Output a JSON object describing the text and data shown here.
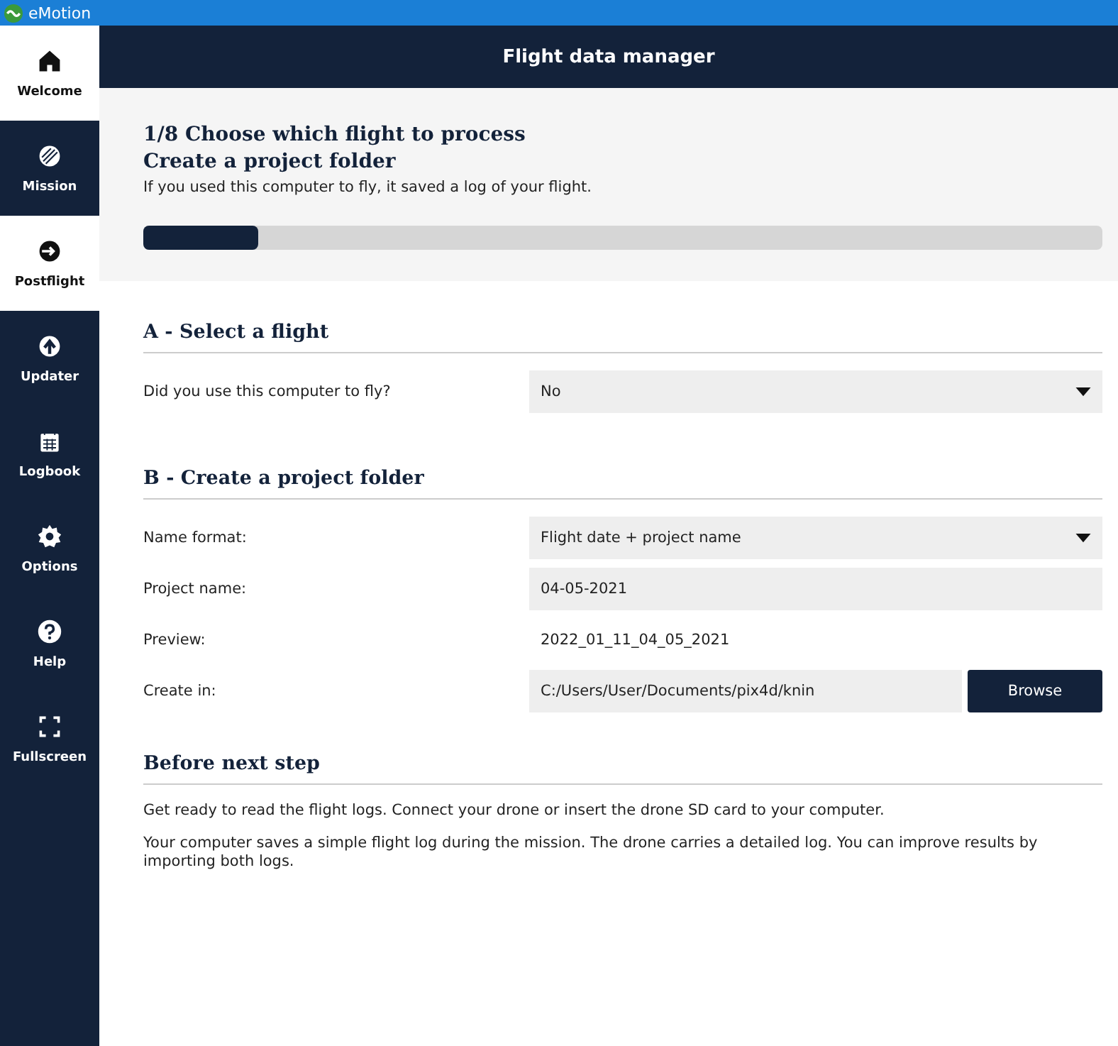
{
  "window": {
    "title": "eMotion"
  },
  "sidebar": {
    "items": [
      {
        "label": "Welcome",
        "kind": "home",
        "selected": true
      },
      {
        "label": "Mission",
        "kind": "mission",
        "selected": false
      },
      {
        "label": "Postflight",
        "kind": "postflight",
        "selected": true
      },
      {
        "label": "Updater",
        "kind": "updater",
        "selected": false
      },
      {
        "label": "Logbook",
        "kind": "logbook",
        "selected": false
      },
      {
        "label": "Options",
        "kind": "options",
        "selected": false
      },
      {
        "label": "Help",
        "kind": "help",
        "selected": false
      },
      {
        "label": "Fullscreen",
        "kind": "fullscreen",
        "selected": false
      }
    ]
  },
  "header": {
    "title": "Flight data manager"
  },
  "step": {
    "title": "1/8 Choose which flight to process",
    "subtitle": "Create a project folder",
    "description": "If you used this computer to fly, it saved a log of your flight.",
    "level": 0.12
  },
  "sections": [
    {
      "title": "A - Select a flight",
      "rows": [
        {
          "kind": "dropdown",
          "label": "Did you use this computer to fly?",
          "value": "No"
        }
      ]
    },
    {
      "title": "B - Create a project folder",
      "rows": [
        {
          "kind": "dropdown",
          "label": "Name format:",
          "value": "Flight date + project name"
        },
        {
          "kind": "field",
          "label": "Project name:",
          "value": "04-05-2021"
        },
        {
          "kind": "text",
          "label": "Preview:",
          "value": "2022_01_11_04_05_2021"
        },
        {
          "kind": "browse",
          "label": "Create in:",
          "value": "C:/Users/User/Documents/pix4d/knin",
          "button": "Browse"
        }
      ]
    },
    {
      "title": "Before next step",
      "paragraphs": [
        "Get ready to read the flight logs. Connect your drone or insert the drone SD card to your computer.",
        "Your computer saves a simple flight log during the mission. The drone carries a detailed log. You can improve results by importing both logs."
      ]
    }
  ]
}
